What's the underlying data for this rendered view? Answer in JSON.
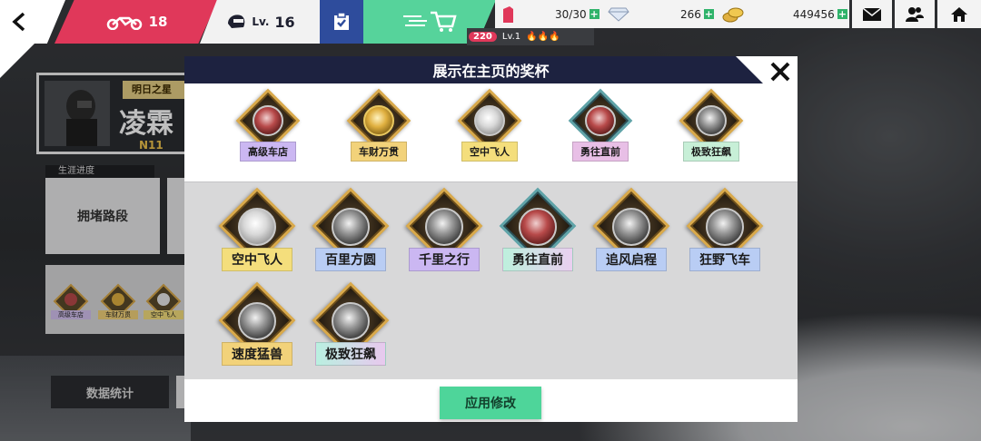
{
  "topbar": {
    "motorcycle_count": "18",
    "level_prefix": "Lv.",
    "level_value": "16",
    "fuel": "30/30",
    "diamonds": "266",
    "coins": "449456",
    "rank_badge": "220",
    "rank_level": "Lv.1"
  },
  "profile": {
    "title_tag": "明日之星",
    "name": "凌霖",
    "id": "N11",
    "career_label": "生涯进度",
    "career_value": "拥堵路段",
    "stats_button": "数据统计",
    "mini_trophies": [
      "高级车店",
      "车财万贯",
      "空中飞人"
    ]
  },
  "modal": {
    "title": "展示在主页的奖杯",
    "apply_button": "应用修改",
    "selected_trophies": [
      {
        "label": "高级车店",
        "color": "#cbb7f2"
      },
      {
        "label": "车财万贯",
        "color": "#f2d27a"
      },
      {
        "label": "空中飞人",
        "color": "#f4de7c"
      },
      {
        "label": "勇往直前",
        "color": "#e8bfe6"
      },
      {
        "label": "极致狂飙",
        "color": "#c7efd7"
      }
    ],
    "owned_trophies": [
      {
        "label": "空中飞人",
        "color": "#f4de7c"
      },
      {
        "label": "百里方圆",
        "color": "#b9cdf4"
      },
      {
        "label": "千里之行",
        "color": "#cbb7f2"
      },
      {
        "label": "勇往直前",
        "color": "#bdf0dd"
      },
      {
        "label": "追风启程",
        "color": "#b9cdf4"
      },
      {
        "label": "狂野飞车",
        "color": "#b9cdf4"
      },
      {
        "label": "速度猛兽",
        "color": "#f2d27a"
      },
      {
        "label": "极致狂飙",
        "color": "#b9f0e0"
      }
    ]
  },
  "colors": {
    "accent_red": "#e0385a",
    "accent_green": "#4ed59a",
    "header_navy": "#1d2240",
    "task_blue": "#2e4c9c"
  }
}
